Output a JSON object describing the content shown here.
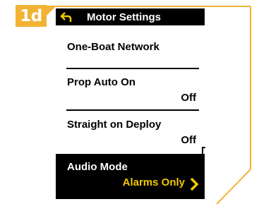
{
  "step": "1d",
  "screen": {
    "title": "Motor Settings",
    "items": [
      {
        "label": "One-Boat Network",
        "value": ""
      },
      {
        "label": "Prop Auto On",
        "value": "Off"
      },
      {
        "label": "Straight on Deploy",
        "value": "Off"
      },
      {
        "label": "Audio Mode",
        "value": "Alarms Only",
        "selected": true
      }
    ]
  },
  "colors": {
    "accent": "#f2b234",
    "highlight_text": "#f2c800",
    "screen_bg": "#000000"
  },
  "icons": [
    "back-arrow-icon",
    "chevron-right-icon"
  ]
}
